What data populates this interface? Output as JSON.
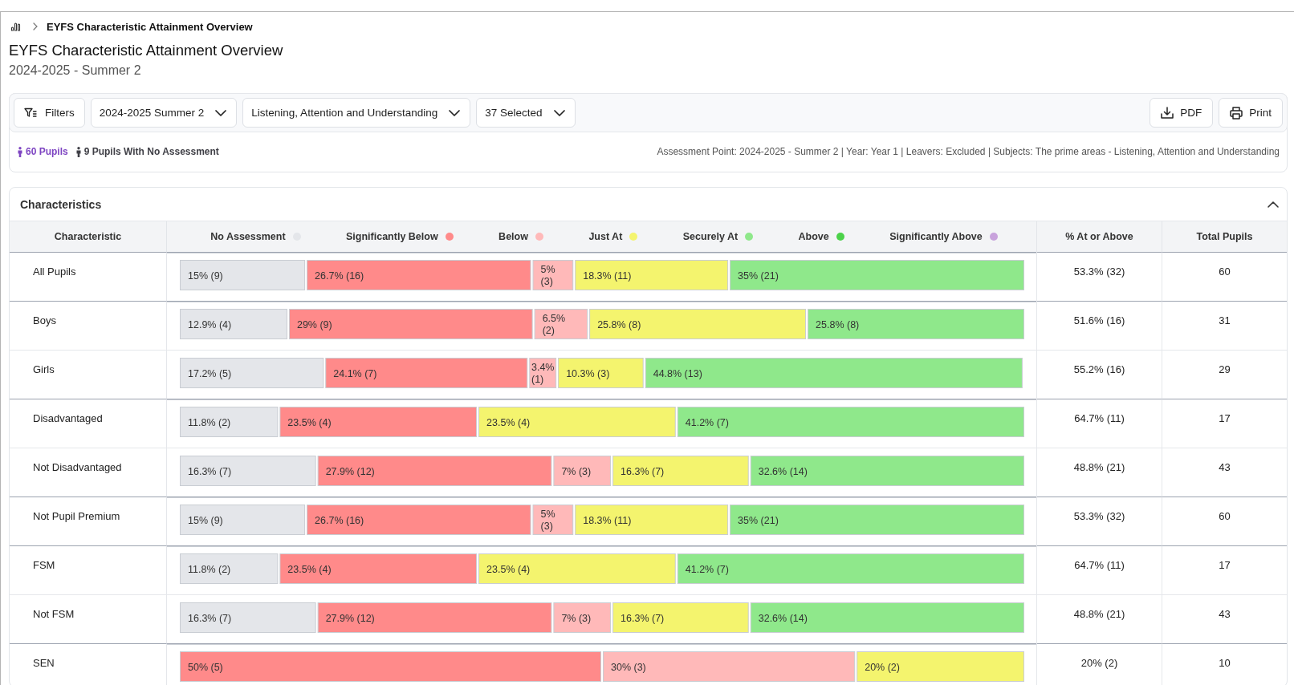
{
  "breadcrumb": {
    "current": "EYFS Characteristic Attainment Overview"
  },
  "page": {
    "title": "EYFS Characteristic Attainment Overview",
    "subtitle": "2024-2025 - Summer 2"
  },
  "toolbar": {
    "filters_button": "Filters",
    "dropdowns": [
      "2024-2025 Summer 2",
      "Listening, Attention and Understanding",
      "37 Selected"
    ],
    "actions": [
      {
        "kind": "download",
        "label": "PDF"
      },
      {
        "kind": "print",
        "label": "Print"
      }
    ]
  },
  "summary": {
    "counts": [
      {
        "label": "60 Pupils",
        "color": "#7e45c2"
      },
      {
        "label": "9 Pupils With No Assessment",
        "color": "#3f3f46"
      }
    ],
    "details": "Assessment Point: 2024-2025 - Summer 2 | Year: Year 1 | Leavers: Excluded | Subjects: The prime areas - Listening, Attention and Understanding"
  },
  "characteristics": {
    "title": "Characteristics",
    "expanded": true,
    "columns": [
      "Characteristic",
      "% At or Above",
      "Total Pupils"
    ],
    "chart_data": {
      "type": "bar",
      "orientation": "horizontal",
      "stacked": true,
      "data_labels": true,
      "series": [
        {
          "name": "No Assessment",
          "color": "#e4e6ea",
          "values": [
            15,
            12.9,
            17.2,
            11.8,
            16.3,
            15,
            11.8,
            16.3,
            0
          ],
          "value_labels": [
            "15% (9)",
            "12.9% (4)",
            "17.2% (5)",
            "11.8% (2)",
            "16.3% (7)",
            "15% (9)",
            "11.8% (2)",
            "16.3% (7)",
            null
          ]
        },
        {
          "name": "Significantly Below",
          "color": "#ff8a8a",
          "values": [
            26.7,
            29,
            24.1,
            23.5,
            27.9,
            26.7,
            23.5,
            27.9,
            50
          ],
          "value_labels": [
            "26.7% (16)",
            "29% (9)",
            "24.1% (7)",
            "23.5% (4)",
            "27.9% (12)",
            "26.7% (16)",
            "23.5% (4)",
            "27.9% (12)",
            "50% (5)"
          ]
        },
        {
          "name": "Below",
          "color": "#ffb9b9",
          "values": [
            5,
            6.5,
            3.4,
            0,
            7,
            5,
            0,
            7,
            30
          ],
          "value_labels": [
            "5% (3)",
            "6.5% (2)",
            "3.4% (1)",
            null,
            "7% (3)",
            "5% (3)",
            null,
            "7% (3)",
            "30% (3)"
          ]
        },
        {
          "name": "Just At",
          "color": "#f4f46e",
          "values": [
            18.3,
            25.8,
            10.3,
            23.5,
            16.3,
            18.3,
            23.5,
            16.3,
            20
          ],
          "value_labels": [
            "18.3% (11)",
            "25.8% (8)",
            "10.3% (3)",
            "23.5% (4)",
            "16.3% (7)",
            "18.3% (11)",
            "23.5% (4)",
            "16.3% (7)",
            "20% (2)"
          ]
        },
        {
          "name": "Securely At",
          "color": "#8fe88b",
          "values": [
            35,
            25.8,
            44.8,
            41.2,
            32.6,
            35,
            41.2,
            32.6,
            0
          ],
          "value_labels": [
            "35% (21)",
            "25.8% (8)",
            "44.8% (13)",
            "41.2% (7)",
            "32.6% (14)",
            "35% (21)",
            "41.2% (7)",
            "32.6% (14)",
            null
          ]
        },
        {
          "name": "Above",
          "color": "#4cd24a",
          "values": [
            0,
            0,
            0,
            0,
            0,
            0,
            0,
            0,
            0
          ],
          "value_labels": [
            null,
            null,
            null,
            null,
            null,
            null,
            null,
            null,
            null
          ]
        },
        {
          "name": "Significantly Above",
          "color": "#c8a2dc",
          "values": [
            0,
            0,
            0,
            0,
            0,
            0,
            0,
            0,
            0
          ],
          "value_labels": [
            null,
            null,
            null,
            null,
            null,
            null,
            null,
            null,
            null
          ]
        }
      ]
    },
    "rows": [
      {
        "label": "All Pupils",
        "group_start": true,
        "at_or_above": "53.3% (32)",
        "total": "60"
      },
      {
        "label": "Boys",
        "group_start": true,
        "at_or_above": "51.6% (16)",
        "total": "31"
      },
      {
        "label": "Girls",
        "group_start": false,
        "at_or_above": "55.2% (16)",
        "total": "29"
      },
      {
        "label": "Disadvantaged",
        "group_start": true,
        "at_or_above": "64.7% (11)",
        "total": "17"
      },
      {
        "label": "Not Disadvantaged",
        "group_start": false,
        "at_or_above": "48.8% (21)",
        "total": "43"
      },
      {
        "label": "Not Pupil Premium",
        "group_start": true,
        "at_or_above": "53.3% (32)",
        "total": "60"
      },
      {
        "label": "FSM",
        "group_start": true,
        "at_or_above": "64.7% (11)",
        "total": "17"
      },
      {
        "label": "Not FSM",
        "group_start": false,
        "at_or_above": "48.8% (21)",
        "total": "43"
      },
      {
        "label": "SEN",
        "group_start": true,
        "at_or_above": "20% (2)",
        "total": "10"
      }
    ]
  }
}
